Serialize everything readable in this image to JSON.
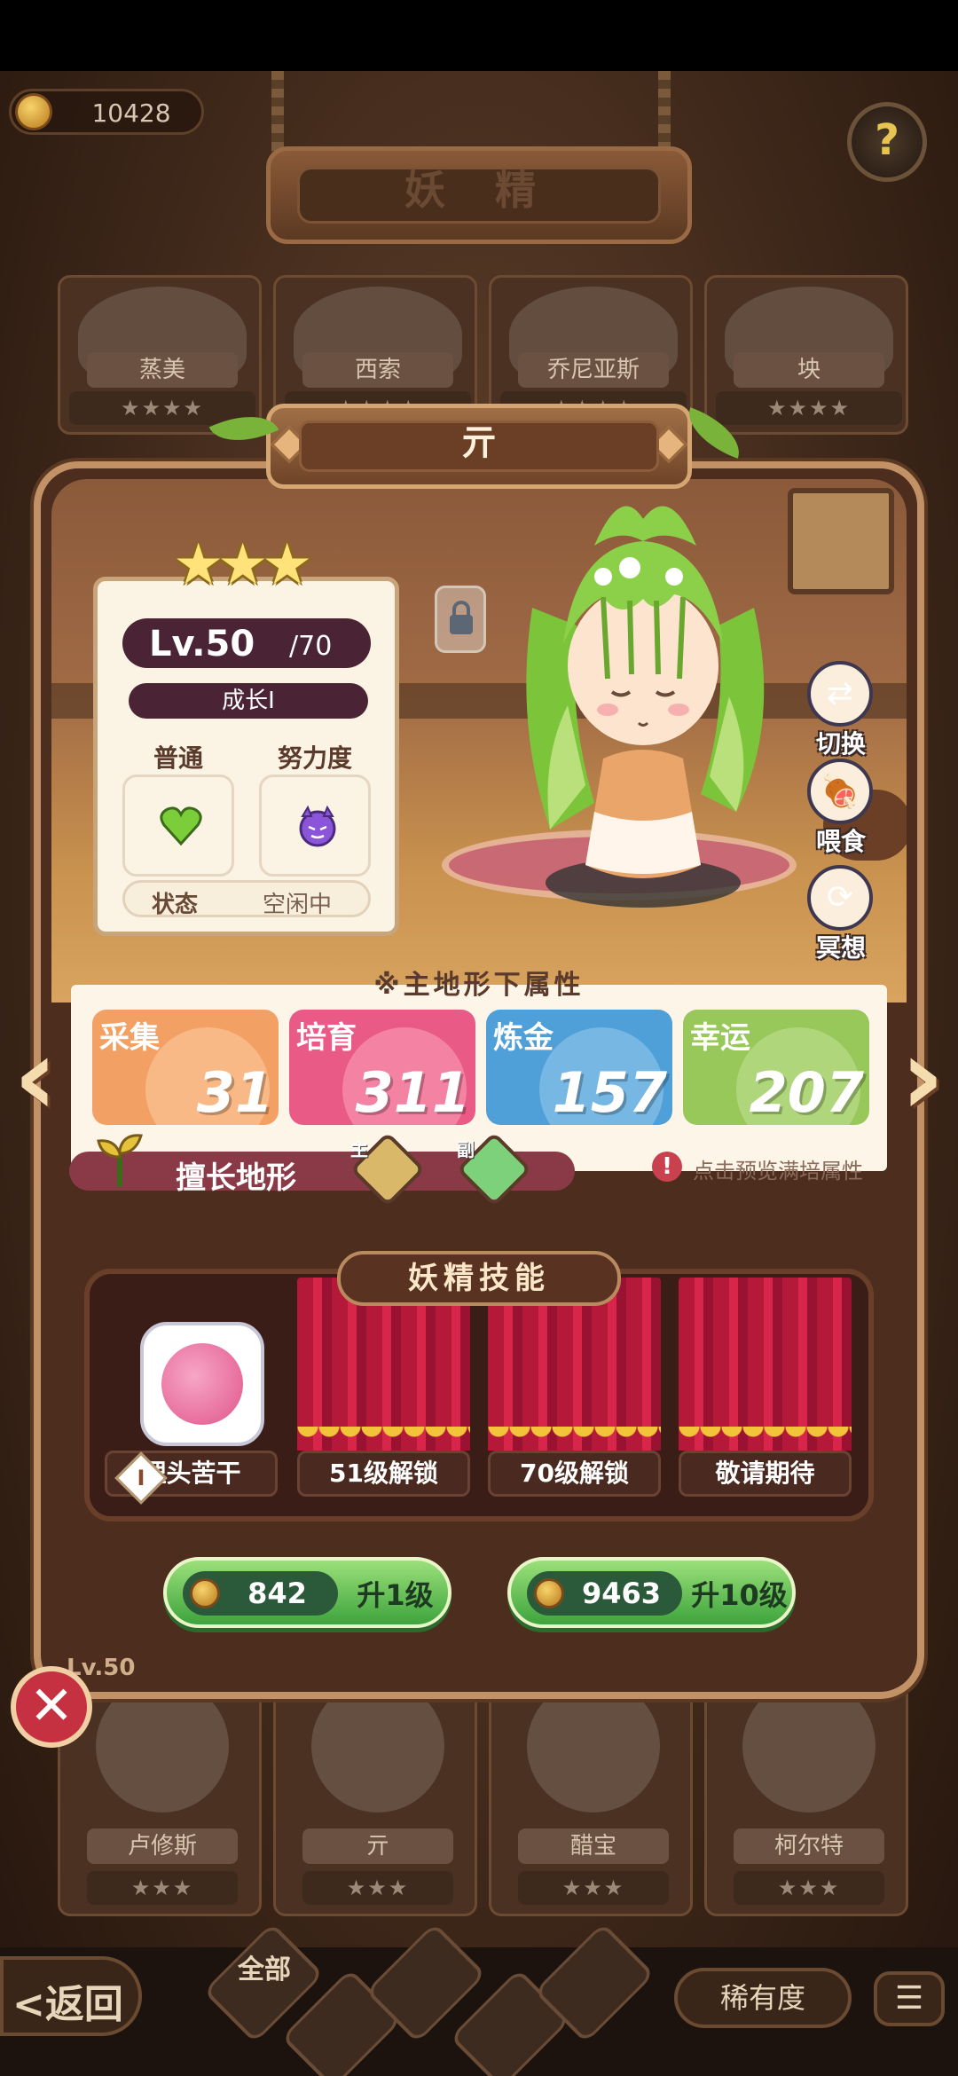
{
  "top": {
    "currency": "10428",
    "title": "妖 精",
    "help_icon": "?"
  },
  "roster_top": [
    {
      "name": "蒸美",
      "stars": "★★★★"
    },
    {
      "name": "西索",
      "stars": "★★★★"
    },
    {
      "name": "乔尼亚斯",
      "stars": "★★★★"
    },
    {
      "name": "坱",
      "stars": "★★★★"
    }
  ],
  "roster_bottom": [
    {
      "name": "卢修斯",
      "stars": "★★★"
    },
    {
      "name": "亓",
      "stars": "★★★"
    },
    {
      "name": "醋宝",
      "stars": "★★★"
    },
    {
      "name": "柯尔特",
      "stars": "★★★"
    }
  ],
  "fairy": {
    "name": "亓",
    "stars": 3,
    "level": "Lv.50",
    "max_level": "/70",
    "growth": "成长I",
    "rarity_label": "普通",
    "effort_label": "努力度",
    "status_key": "状态",
    "status_value": "空闲中"
  },
  "side_actions": {
    "switch": "切换",
    "feed": "喂食",
    "meditate": "冥想"
  },
  "attributes": {
    "note": "※主地形下属性",
    "items": [
      {
        "label": "采集",
        "value": "31",
        "color": "#f2a064"
      },
      {
        "label": "培育",
        "value": "311",
        "color": "#ea5a86"
      },
      {
        "label": "炼金",
        "value": "157",
        "color": "#4f9fd8"
      },
      {
        "label": "幸运",
        "value": "207",
        "color": "#98c75a"
      }
    ],
    "terrain_label": "擅长地形",
    "main_tag": "主",
    "sub_tag": "副",
    "preview_text": "点击预览满培属性"
  },
  "skills": {
    "title": "妖精技能",
    "slots": [
      {
        "label": "埋头苦干",
        "index": "I"
      },
      {
        "label": "51级解锁"
      },
      {
        "label": "70级解锁"
      },
      {
        "label": "敬请期待"
      }
    ]
  },
  "upgrade": [
    {
      "cost": "842",
      "action": "升1级"
    },
    {
      "cost": "9463",
      "action": "升10级"
    }
  ],
  "bottom": {
    "back": "<返回",
    "all": "全部",
    "rarity": "稀有度",
    "lv_tag": "Lv.50"
  },
  "colors": {
    "accent_green": "#3ea43d",
    "panel_brown": "#4c2d1e",
    "curtain_red": "#b4193a"
  }
}
